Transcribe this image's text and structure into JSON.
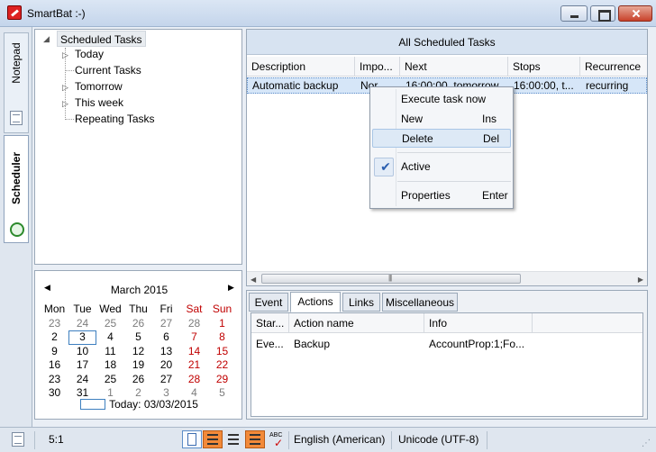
{
  "window": {
    "title": "SmartBat :-)"
  },
  "side_tabs": {
    "notepad": "Notepad",
    "scheduler": "Scheduler"
  },
  "tree": {
    "root": "Scheduled Tasks",
    "items": [
      "Today",
      "Current Tasks",
      "Tomorrow",
      "This week",
      "Repeating Tasks"
    ]
  },
  "calendar": {
    "month": "March 2015",
    "weekdays": [
      "Mon",
      "Tue",
      "Wed",
      "Thu",
      "Fri",
      "Sat",
      "Sun"
    ],
    "weeks": [
      [
        "23",
        "24",
        "25",
        "26",
        "27",
        "28",
        "1"
      ],
      [
        "2",
        "3",
        "4",
        "5",
        "6",
        "7",
        "8"
      ],
      [
        "9",
        "10",
        "11",
        "12",
        "13",
        "14",
        "15"
      ],
      [
        "16",
        "17",
        "18",
        "19",
        "20",
        "21",
        "22"
      ],
      [
        "23",
        "24",
        "25",
        "26",
        "27",
        "28",
        "29"
      ],
      [
        "30",
        "31",
        "1",
        "2",
        "3",
        "4",
        "5"
      ]
    ],
    "selected": "3",
    "today_label": "Today: 03/03/2015",
    "weekend_color": "#c00000",
    "dim_color": "#7c7c7c"
  },
  "tasks_panel": {
    "title": "All Scheduled Tasks",
    "columns": [
      "Description",
      "Impo...",
      "Next",
      "Stops",
      "Recurrence"
    ],
    "rows": [
      {
        "description": "Automatic backup",
        "importance": "Nor...",
        "next": "16:00:00, tomorrow",
        "stops": "16:00:00, t...",
        "recurrence": "recurring"
      }
    ]
  },
  "context_menu": {
    "execute": "Execute task now",
    "new": "New",
    "new_key": "Ins",
    "delete": "Delete",
    "delete_key": "Del",
    "active": "Active",
    "check": "✔",
    "properties": "Properties",
    "properties_key": "Enter"
  },
  "detail_tabs": [
    "Event",
    "Actions",
    "Links",
    "Miscellaneous"
  ],
  "actions_grid": {
    "columns": [
      "Star...",
      "Action name",
      "Info"
    ],
    "rows": [
      {
        "start": "Eve...",
        "name": "Backup",
        "info": "AccountProp:1;Fo..."
      }
    ]
  },
  "status_bar": {
    "position": "5:1",
    "language": "English (American)",
    "encoding": "Unicode (UTF-8)",
    "abc": "ABC"
  },
  "colors": {
    "accent": "#3d7fbf",
    "header_bg": "#d7e3f1",
    "orange": "#f28a3a"
  }
}
